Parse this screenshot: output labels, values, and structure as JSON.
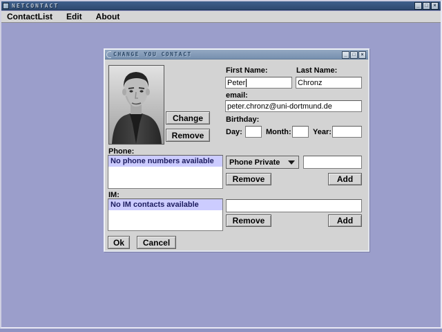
{
  "window": {
    "title": "NETCONTACT",
    "minimize_glyph": "_",
    "maximize_glyph": "□",
    "close_glyph": "×"
  },
  "menubar": {
    "items": [
      "ContactList",
      "Edit",
      "About"
    ]
  },
  "dialog": {
    "title": "CHANGE YOU CONTACT",
    "photo": {
      "description": "grayscale portrait photo of contact",
      "change_label": "Change",
      "remove_label": "Remove"
    },
    "fields": {
      "first_name_label": "First Name:",
      "first_name_value": "Peter",
      "last_name_label": "Last Name:",
      "last_name_value": "Chronz",
      "email_label": "email:",
      "email_value": "peter.chronz@uni-dortmund.de",
      "birthday_label": "Birthday:",
      "day_label": "Day:",
      "day_value": "",
      "month_label": "Month:",
      "month_value": "",
      "year_label": "Year:",
      "year_value": ""
    },
    "phone": {
      "label": "Phone:",
      "empty_message": "No phone numbers available",
      "type_selected": "Phone Private",
      "number_value": "",
      "remove_label": "Remove",
      "add_label": "Add"
    },
    "im": {
      "label": "IM:",
      "empty_message": "No IM contacts available",
      "contact_value": "",
      "remove_label": "Remove",
      "add_label": "Add"
    },
    "actions": {
      "ok_label": "Ok",
      "cancel_label": "Cancel"
    }
  },
  "colors": {
    "desktop": "#9b9ecb",
    "titlebar_active": "#2e4a70",
    "dialog_titlebar": "#7790af",
    "selection_highlight": "#ccccff",
    "panel": "#d3d3d3"
  }
}
